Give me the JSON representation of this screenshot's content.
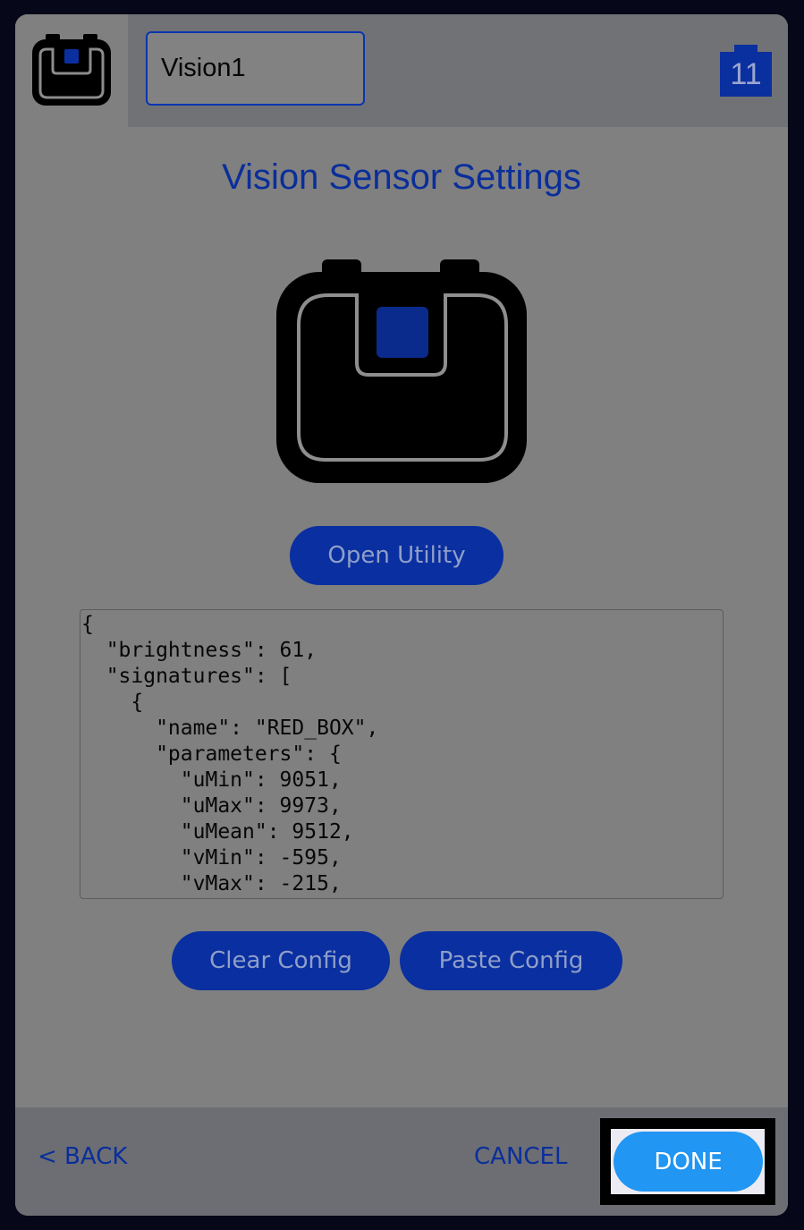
{
  "header": {
    "sensor_name": "Vision1",
    "port_number": "11"
  },
  "main": {
    "title": "Vision Sensor Settings",
    "open_utility_label": "Open Utility",
    "config_text": "{\n  \"brightness\": 61,\n  \"signatures\": [\n    {\n      \"name\": \"RED_BOX\",\n      \"parameters\": {\n        \"uMin\": 9051,\n        \"uMax\": 9973,\n        \"uMean\": 9512,\n        \"vMin\": -595,\n        \"vMax\": -215,",
    "clear_config_label": "Clear Config",
    "paste_config_label": "Paste Config"
  },
  "footer": {
    "back_label": "< BACK",
    "cancel_label": "CANCEL",
    "done_label": "DONE"
  },
  "icons": {
    "header_icon": "vision-sensor-icon",
    "main_image": "vision-sensor-icon",
    "port_badge": "port-badge-icon"
  },
  "colors": {
    "accent": "#0a2fa0",
    "done_button": "#2196f3",
    "panel": "#808080",
    "header": "#717276"
  }
}
